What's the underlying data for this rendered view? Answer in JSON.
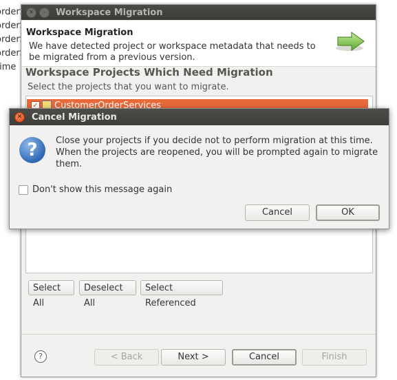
{
  "background": {
    "list_items": [
      "orderS",
      "orderS",
      "orderS",
      "orderS",
      "time"
    ]
  },
  "migration_window": {
    "title": "Workspace Migration",
    "header_title": "Workspace Migration",
    "header_description": "We have detected project or workspace metadata that needs to be migrated from a previous version.",
    "section_title": "Workspace Projects Which Need Migration",
    "section_description": "Select the projects that you want to migrate.",
    "projects": [
      {
        "label": "CustomerOrderServices",
        "checked": true
      }
    ],
    "select_all_label": "Select All",
    "deselect_all_label": "Deselect All",
    "select_referenced_label": "Select Referenced",
    "back_label": "< Back",
    "next_label": "Next >",
    "cancel_label": "Cancel",
    "finish_label": "Finish"
  },
  "cancel_dialog": {
    "title": "Cancel Migration",
    "message": "Close your projects if you decide not to perform migration at this time. When the projects are reopened, you will be prompted again to migrate them.",
    "checkbox_label": "Don't show this message again",
    "checkbox_checked": false,
    "cancel_label": "Cancel",
    "ok_label": "OK"
  },
  "colors": {
    "selection_highlight": "#e8693a",
    "titlebar": "#3c3c38",
    "close_button": "#df4a16",
    "dialog_bg": "#f2f1f0"
  },
  "icons": {
    "question": "question-icon",
    "arrow": "green-arrow-icon",
    "help": "help-icon",
    "close": "close-icon"
  }
}
